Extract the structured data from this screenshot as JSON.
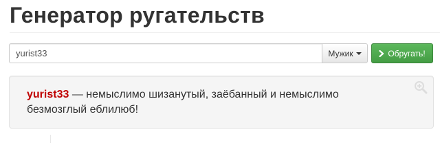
{
  "header": {
    "title": "Генератор ругательств"
  },
  "form": {
    "name_input": {
      "value": "yurist33",
      "placeholder": ""
    },
    "gender_select": {
      "selected": "Мужик",
      "icon": "caret-down-icon"
    },
    "submit_button": {
      "label": "Обругать!",
      "icon": "chevron-right-icon"
    }
  },
  "result": {
    "name": "yurist33",
    "text": " — немыслимо шизанутый, заёбанный и немыслимо безмозглый еблилюб!",
    "icon": "zoom-in-icon"
  },
  "colors": {
    "accent_green": "#5cb85c",
    "name_red": "#c00000",
    "panel_background": "#f5f5f5"
  }
}
